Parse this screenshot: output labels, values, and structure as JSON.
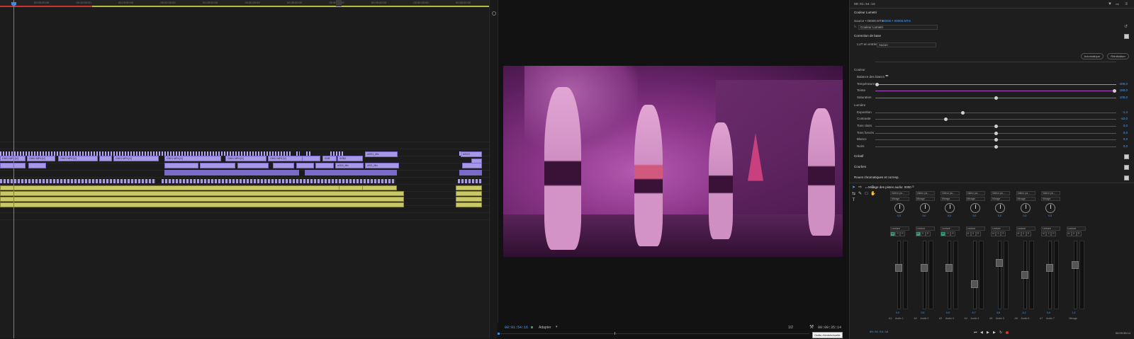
{
  "timeline": {
    "ruler_ticks": [
      "00:05:00:00",
      "00:10:00:00",
      "00:15:00:00",
      "00:20:00:00",
      "00:25:00:00",
      "00:30:00:00",
      "00:35:00:00",
      "00:40:00:00",
      "00:45:00:00",
      "00:50:00:00",
      "00:55:00:00"
    ],
    "clip_labels": [
      "GH01 MP4 [V]",
      "GH01 MP4 [V]",
      "GH01 MP4 [V]",
      "GH01 MP4 [V]",
      "GH01 MP4 [V]",
      "GH01 MP4 [V]",
      "GH01 MP4 [V]",
      "GH01 MP4 [V]",
      "SOB",
      "SOB2",
      "ASO1_Mix",
      "AS03_Mix",
      "ASO_Mix",
      "ASCO"
    ]
  },
  "program": {
    "timecode": "00:01:54:16",
    "fit_label": "Adapter",
    "zoom": "1/2",
    "duration": "00:09:35:14",
    "tooltip": "Outils d'entrée/sortie"
  },
  "lumetri": {
    "header_tc": "00:01:54:16",
    "panel_title": "Couleur Lumetri",
    "source_line": "Source • 00000.MTS",
    "source_link": "00000 • 00000.MTS",
    "effect_name": "Couleur Lumetri",
    "section_basic": "Correction de base",
    "lut_label": "LUT en entrée",
    "lut_value": "Aucun",
    "btn_auto": "Automatique",
    "btn_reset": "Réinitialiser",
    "section_color": "Couleur",
    "wb_label": "Balance des blancs",
    "section_light": "Lumière",
    "sliders": [
      {
        "label": "Température",
        "value": "-100,0",
        "pos": 0.0,
        "color": "#d68a2e"
      },
      {
        "label": "Teinte",
        "value": "150,0",
        "pos": 1.0,
        "color": "#b050c8"
      },
      {
        "label": "Saturation",
        "value": "100,0",
        "pos": 0.5,
        "color": "#777777"
      },
      {
        "label": "Exposition",
        "value": "-1,4",
        "pos": 0.36,
        "color": "#555555"
      },
      {
        "label": "Contraste",
        "value": "-42,0",
        "pos": 0.29,
        "color": "#555555"
      },
      {
        "label": "Tons clairs",
        "value": "0,0",
        "pos": 0.5,
        "color": "#555555"
      },
      {
        "label": "Tons foncés",
        "value": "0,0",
        "pos": 0.5,
        "color": "#555555"
      },
      {
        "label": "Blancs",
        "value": "0,0",
        "pos": 0.5,
        "color": "#555555"
      },
      {
        "label": "Noirs",
        "value": "0,0",
        "pos": 0.5,
        "color": "#555555"
      }
    ],
    "section_creative": "Créatif",
    "section_curves": "Courbes",
    "section_wheels": "Roues chromatiques et corresp."
  },
  "mixer": {
    "title": "Mixage des pistes audio: 0000",
    "tc_left": "00:01:54:16",
    "tc_right": "00:09:35:14",
    "channels": [
      {
        "send": "Valeur pa...",
        "mode": "Mixage",
        "pan": "0,0",
        "read": "Lecture",
        "db": "0,0",
        "name": "Audio 1",
        "tag": "A1",
        "fader": 0.62
      },
      {
        "send": "Valeur pa...",
        "mode": "Mixage",
        "pan": "0,0",
        "read": "Lecture",
        "db": "0,0",
        "name": "Audio 2",
        "tag": "A2",
        "fader": 0.62
      },
      {
        "send": "Valeur pa...",
        "mode": "Mixage",
        "pan": "0,0",
        "read": "Lecture",
        "db": "0,0",
        "name": "Audio 3",
        "tag": "A3",
        "fader": 0.62
      },
      {
        "send": "Valeur pa...",
        "mode": "Mixage",
        "pan": "0,0",
        "read": "Lecture",
        "db": "-9,7",
        "name": "Audio 4",
        "tag": "A4",
        "fader": 0.35
      },
      {
        "send": "Valeur pa...",
        "mode": "Mixage",
        "pan": "0,0",
        "read": "Lecture",
        "db": "3,6",
        "name": "Audio 5",
        "tag": "A5",
        "fader": 0.7
      },
      {
        "send": "Valeur pa...",
        "mode": "Mixage",
        "pan": "0,0",
        "read": "Lecture",
        "db": "-4,2",
        "name": "Audio 6",
        "tag": "A6",
        "fader": 0.5
      },
      {
        "send": "Valeur pa...",
        "mode": "Mixage",
        "pan": "0,0",
        "read": "Lecture",
        "db": "0,0",
        "name": "Audio 7",
        "tag": "A7",
        "fader": 0.62
      },
      {
        "send": "",
        "mode": "",
        "pan": "",
        "read": "Lecture",
        "db": "1,3",
        "name": "Mixage",
        "tag": "",
        "fader": 0.66
      }
    ]
  }
}
